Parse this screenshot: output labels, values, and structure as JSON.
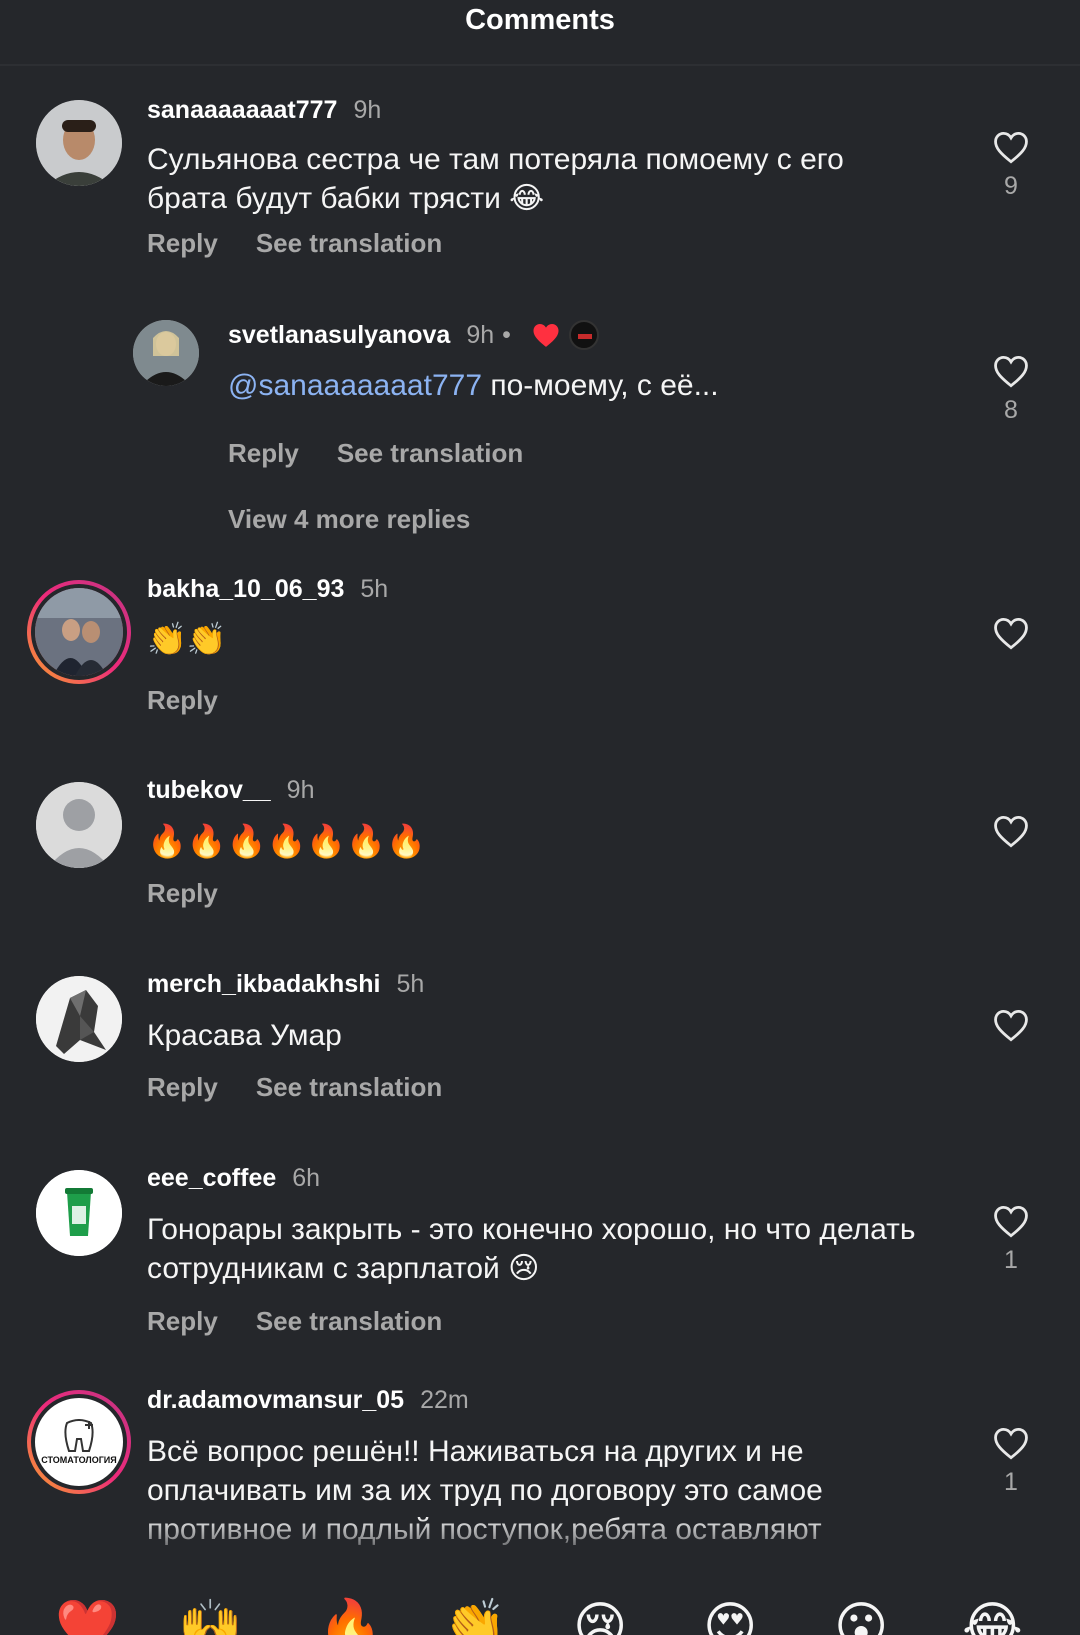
{
  "header": {
    "title": "Comments"
  },
  "comments": [
    {
      "username": "sanaaaaaaat777",
      "time": "9h",
      "text": "Сульянова сестра че там потеряла помоему с его брата будут бабки трясти 😂",
      "reply_label": "Reply",
      "translate_label": "See translation",
      "likes": "9",
      "avatar": "photo-man"
    },
    {
      "username": "svetlanasulyanova",
      "time": "9h",
      "dot": "•",
      "mention": "@sanaaaaaaat777",
      "text": " по-моему, с её...",
      "reply_label": "Reply",
      "translate_label": "See translation",
      "likes": "8",
      "avatar": "photo-woman",
      "badges": [
        "heart-icon",
        "prime-badge-icon"
      ],
      "view_more": "View 4 more replies"
    },
    {
      "username": "bakha_10_06_93",
      "time": "5h",
      "text": "👏👏",
      "reply_label": "Reply",
      "avatar": "photo-group-story"
    },
    {
      "username": "tubekov__",
      "time": "9h",
      "text": "🔥🔥🔥🔥🔥🔥🔥",
      "reply_label": "Reply",
      "avatar": "default-user"
    },
    {
      "username": "merch_ikbadakhshi",
      "time": "5h",
      "text": "Красава Умар",
      "reply_label": "Reply",
      "translate_label": "See translation",
      "avatar": "graphic-warrior"
    },
    {
      "username": "eee_coffee",
      "time": "6h",
      "text": "Гонорары закрыть - это конечно хорошо, но что делать сотрудникам с зарплатой 😢",
      "reply_label": "Reply",
      "translate_label": "See translation",
      "likes": "1",
      "avatar": "coffee-cup-logo"
    },
    {
      "username": "dr.adamovmansur_05",
      "time": "22m",
      "text": "Всё вопрос решён!! Наживаться на других и не оплачивать им за их труд по договору это самое противное и подлый поступок,ребята оставляют",
      "likes": "1",
      "avatar": "dental-logo-story",
      "avatar_text": "СТОМАТОЛОГИЯ"
    }
  ],
  "reactions": [
    "❤️",
    "🙌",
    "🔥",
    "👏",
    "😢",
    "😍",
    "😮",
    "😂"
  ],
  "colors": {
    "background": "#25272b",
    "muted": "#a8a8a8",
    "mention": "#8cb3f2",
    "heart_red": "#ff3040"
  }
}
